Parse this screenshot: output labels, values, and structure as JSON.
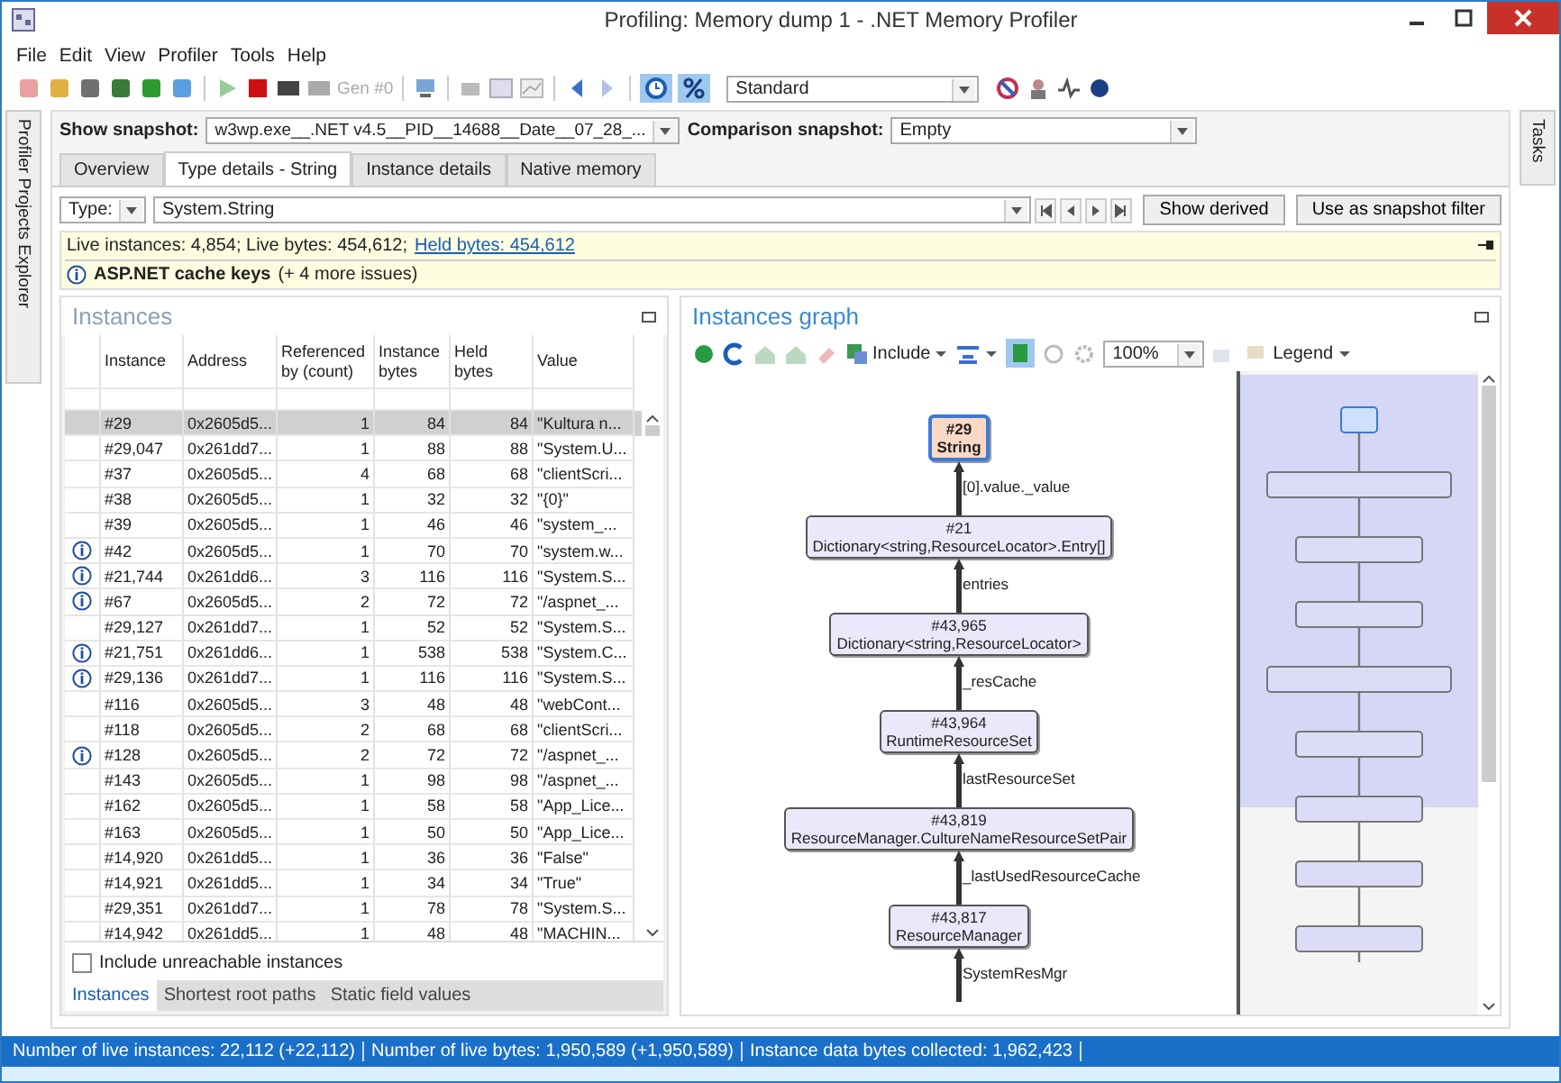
{
  "window": {
    "title": "Profiling: Memory dump 1 - .NET Memory Profiler"
  },
  "menu": [
    "File",
    "Edit",
    "View",
    "Profiler",
    "Tools",
    "Help"
  ],
  "toolbar": {
    "gen_label": "Gen #0",
    "layout_combo": "Standard"
  },
  "side_tabs": {
    "left": "Profiler Projects Explorer",
    "right": "Tasks"
  },
  "snapshot": {
    "show_label": "Show snapshot:",
    "show_value": "w3wp.exe__.NET v4.5__PID__14688__Date__07_28_...",
    "comparison_label": "Comparison snapshot:",
    "comparison_value": "Empty"
  },
  "tabs": [
    {
      "label": "Overview",
      "selected": false
    },
    {
      "label": "Type details - String",
      "selected": true
    },
    {
      "label": "Instance details",
      "selected": false
    },
    {
      "label": "Native memory",
      "selected": false
    }
  ],
  "type_filter": {
    "label": "Type:",
    "value": "System.String",
    "buttons": [
      "Show derived",
      "Use as snapshot filter"
    ]
  },
  "info_bar": {
    "stats": "Live instances: 4,854; Live bytes: 454,612;",
    "link": "Held bytes: 454,612",
    "issue": "ASP.NET cache keys",
    "issue_more": "(+ 4 more issues)"
  },
  "instances": {
    "title": "Instances",
    "columns": [
      "Instance",
      "Address",
      "Referenced by (count)",
      "Instance bytes",
      "Held bytes",
      "Value"
    ],
    "rows": [
      {
        "issue": false,
        "selected": true,
        "cells": [
          "#29",
          "0x2605d5...",
          "1",
          "84",
          "84",
          "\"Kultura n..."
        ]
      },
      {
        "issue": false,
        "selected": false,
        "cells": [
          "#29,047",
          "0x261dd7...",
          "1",
          "88",
          "88",
          "\"System.U..."
        ]
      },
      {
        "issue": false,
        "selected": false,
        "cells": [
          "#37",
          "0x2605d5...",
          "4",
          "68",
          "68",
          "\"clientScri..."
        ]
      },
      {
        "issue": false,
        "selected": false,
        "cells": [
          "#38",
          "0x2605d5...",
          "1",
          "32",
          "32",
          "\"{0}\""
        ]
      },
      {
        "issue": false,
        "selected": false,
        "cells": [
          "#39",
          "0x2605d5...",
          "1",
          "46",
          "46",
          "\"system_..."
        ]
      },
      {
        "issue": true,
        "selected": false,
        "cells": [
          "#42",
          "0x2605d5...",
          "1",
          "70",
          "70",
          "\"system.w..."
        ]
      },
      {
        "issue": true,
        "selected": false,
        "cells": [
          "#21,744",
          "0x261dd6...",
          "3",
          "116",
          "116",
          "\"System.S..."
        ]
      },
      {
        "issue": true,
        "selected": false,
        "cells": [
          "#67",
          "0x2605d5...",
          "2",
          "72",
          "72",
          "\"/aspnet_..."
        ]
      },
      {
        "issue": false,
        "selected": false,
        "cells": [
          "#29,127",
          "0x261dd7...",
          "1",
          "52",
          "52",
          "\"System.S..."
        ]
      },
      {
        "issue": true,
        "selected": false,
        "cells": [
          "#21,751",
          "0x261dd6...",
          "1",
          "538",
          "538",
          "\"System.C..."
        ]
      },
      {
        "issue": true,
        "selected": false,
        "cells": [
          "#29,136",
          "0x261dd7...",
          "1",
          "116",
          "116",
          "\"System.S..."
        ]
      },
      {
        "issue": false,
        "selected": false,
        "cells": [
          "#116",
          "0x2605d5...",
          "3",
          "48",
          "48",
          "\"webCont..."
        ]
      },
      {
        "issue": false,
        "selected": false,
        "cells": [
          "#118",
          "0x2605d5...",
          "2",
          "68",
          "68",
          "\"clientScri..."
        ]
      },
      {
        "issue": true,
        "selected": false,
        "cells": [
          "#128",
          "0x2605d5...",
          "2",
          "72",
          "72",
          "\"/aspnet_..."
        ]
      },
      {
        "issue": false,
        "selected": false,
        "cells": [
          "#143",
          "0x2605d5...",
          "1",
          "98",
          "98",
          "\"/aspnet_..."
        ]
      },
      {
        "issue": false,
        "selected": false,
        "cells": [
          "#162",
          "0x2605d5...",
          "1",
          "58",
          "58",
          "\"App_Lice..."
        ]
      },
      {
        "issue": false,
        "selected": false,
        "cells": [
          "#163",
          "0x2605d5...",
          "1",
          "50",
          "50",
          "\"App_Lice..."
        ]
      },
      {
        "issue": false,
        "selected": false,
        "cells": [
          "#14,920",
          "0x261dd5...",
          "1",
          "36",
          "36",
          "\"False\""
        ]
      },
      {
        "issue": false,
        "selected": false,
        "cells": [
          "#14,921",
          "0x261dd5...",
          "1",
          "34",
          "34",
          "\"True\""
        ]
      },
      {
        "issue": false,
        "selected": false,
        "cells": [
          "#29,351",
          "0x261dd7...",
          "1",
          "78",
          "78",
          "\"System.S..."
        ]
      },
      {
        "issue": false,
        "selected": false,
        "cells": [
          "#14,942",
          "0x261dd5...",
          "1",
          "48",
          "48",
          "\"MACHIN..."
        ]
      }
    ],
    "include_unreachable": {
      "label": "Include unreachable instances",
      "checked": false
    },
    "bottom_tabs": [
      {
        "label": "Instances",
        "selected": true
      },
      {
        "label": "Shortest root paths",
        "selected": false
      },
      {
        "label": "Static field values",
        "selected": false
      }
    ]
  },
  "graph": {
    "title": "Instances graph",
    "include_label": "Include",
    "zoom": "100%",
    "legend_label": "Legend",
    "nodes": [
      {
        "id": "#29",
        "type": "String",
        "selected": true,
        "edge": "[0].value._value"
      },
      {
        "id": "#21",
        "type": "Dictionary<string,ResourceLocator>.Entry[]",
        "selected": false,
        "edge": "entries"
      },
      {
        "id": "#43,965",
        "type": "Dictionary<string,ResourceLocator>",
        "selected": false,
        "edge": "_resCache"
      },
      {
        "id": "#43,964",
        "type": "RuntimeResourceSet",
        "selected": false,
        "edge": "lastResourceSet"
      },
      {
        "id": "#43,819",
        "type": "ResourceManager.CultureNameResourceSetPair",
        "selected": false,
        "edge": "_lastUsedResourceCache"
      },
      {
        "id": "#43,817",
        "type": "ResourceManager",
        "selected": false,
        "edge": "SystemResMgr"
      }
    ]
  },
  "status_bar": [
    "Number of live instances: 22,112 (+22,112)",
    "Number of live bytes: 1,950,589 (+1,950,589)",
    "Instance data bytes collected: 1,962,423"
  ]
}
